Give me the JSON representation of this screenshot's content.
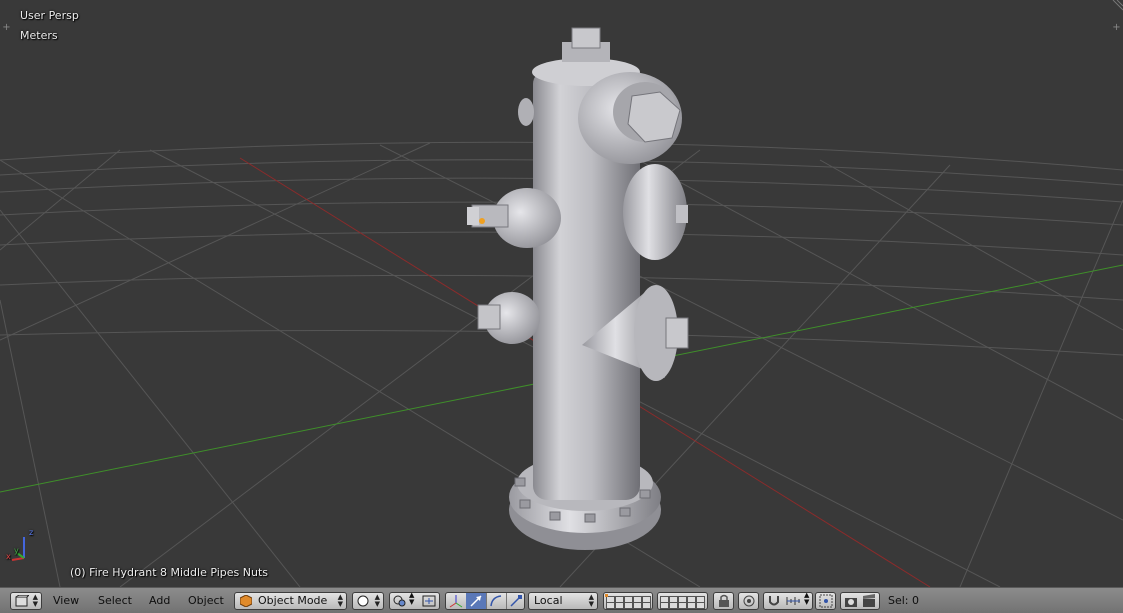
{
  "viewport": {
    "view_label": "User Persp",
    "units_label": "Meters",
    "object_info": "(0) Fire Hydrant 8 Middle Pipes Nuts",
    "colors": {
      "background": "#393939",
      "grid": "#5a5a5a",
      "x_axis": "#8b2b2b",
      "y_axis": "#3f8f2a",
      "hydrant": "#c4c4c8"
    },
    "axis_letters": {
      "x": "x",
      "y": "y",
      "z": "z"
    }
  },
  "header": {
    "editor_type_icon": "3d-view-icon",
    "menus": [
      "View",
      "Select",
      "Add",
      "Object"
    ],
    "mode": {
      "icon": "cube-icon",
      "label": "Object Mode"
    },
    "shading_icon": "solid-sphere-icon",
    "pivot_icon": "pivot-point-icon",
    "manipulator_icons": [
      "translate-icon",
      "rotate-icon",
      "scale-icon"
    ],
    "orientation": "Local",
    "status": "Sel: 0"
  }
}
